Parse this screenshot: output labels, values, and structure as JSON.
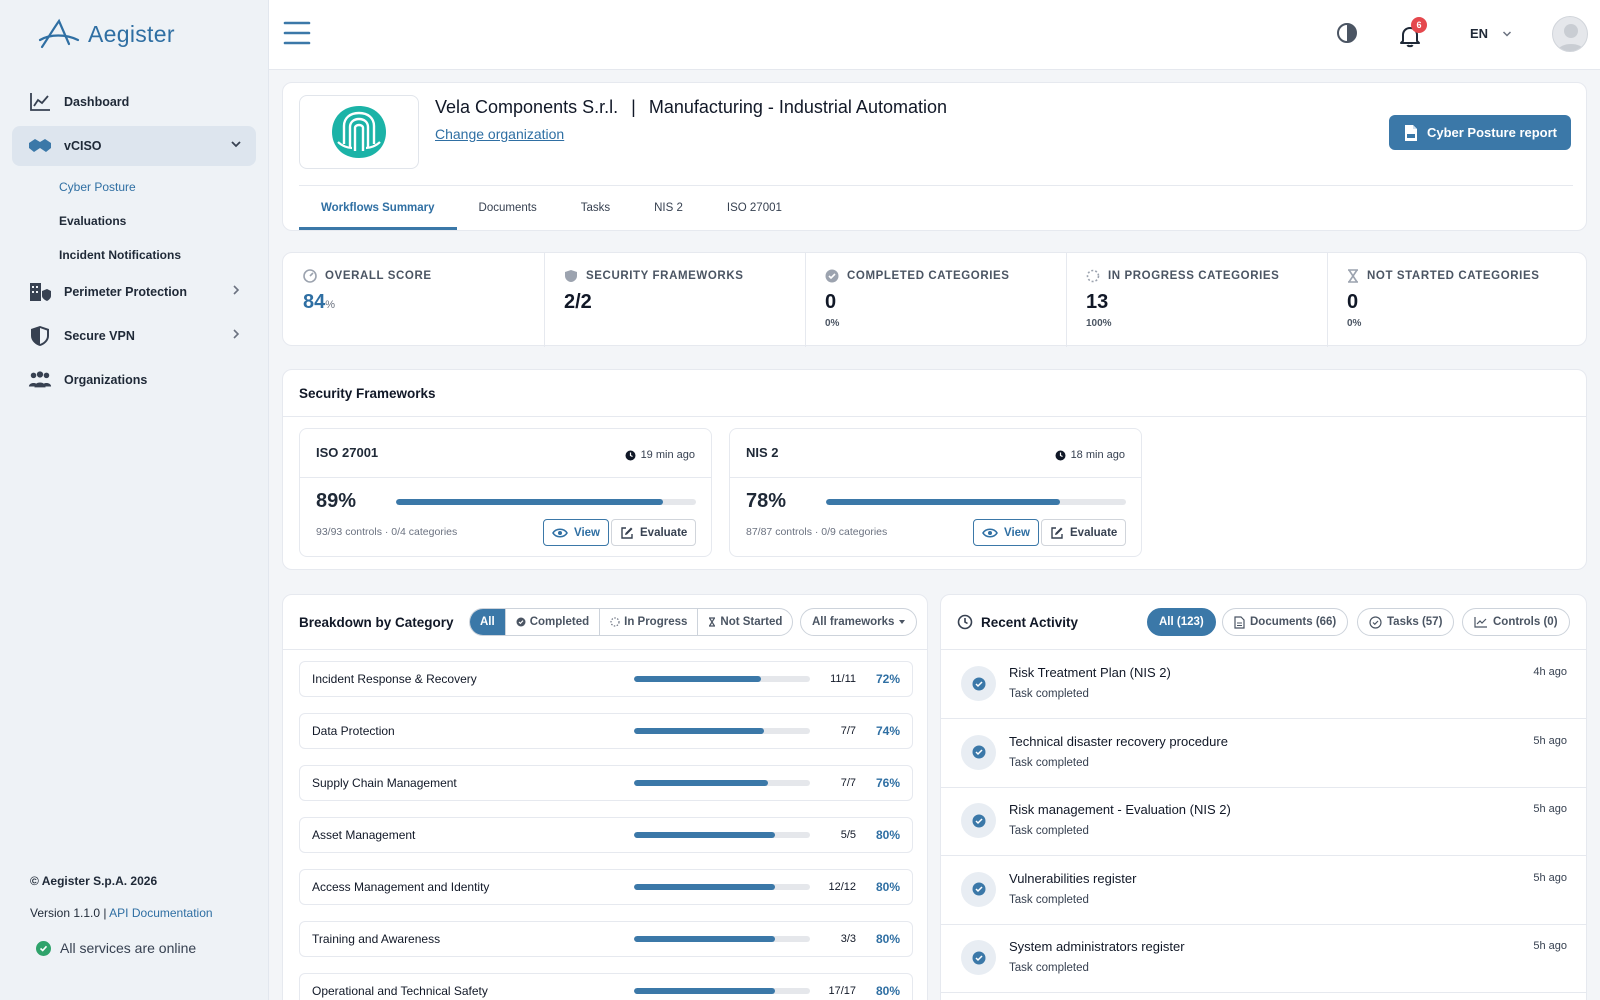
{
  "brand": {
    "name": "Aegister"
  },
  "sidebar": {
    "items": [
      {
        "label": "Dashboard"
      },
      {
        "label": "vCISO"
      },
      {
        "label": "Perimeter Protection"
      },
      {
        "label": "Secure VPN"
      },
      {
        "label": "Organizations"
      }
    ],
    "vciso_sub": [
      {
        "label": "Cyber Posture"
      },
      {
        "label": "Evaluations"
      },
      {
        "label": "Incident Notifications"
      }
    ],
    "footer": {
      "copyright": "© Aegister S.p.A. 2026",
      "version": "Version 1.1.0 |",
      "api_link": "API Documentation",
      "status": "All services are online"
    }
  },
  "topbar": {
    "notifications_count": "6",
    "language": "EN"
  },
  "org": {
    "name": "Vela Components S.r.l.",
    "separator": "|",
    "industry": "Manufacturing - Industrial Automation",
    "change_link": "Change organization",
    "report_button": "Cyber Posture report"
  },
  "tabs": [
    {
      "label": "Workflows Summary"
    },
    {
      "label": "Documents"
    },
    {
      "label": "Tasks"
    },
    {
      "label": "NIS 2"
    },
    {
      "label": "ISO 27001"
    }
  ],
  "stats": {
    "overall": {
      "label": "OVERALL SCORE",
      "value": "84",
      "unit": "%"
    },
    "frameworks": {
      "label": "SECURITY FRAMEWORKS",
      "value": "2/2"
    },
    "completed": {
      "label": "COMPLETED CATEGORIES",
      "value": "0",
      "sub": "0%"
    },
    "in_progress": {
      "label": "IN PROGRESS CATEGORIES",
      "value": "13",
      "sub": "100%"
    },
    "not_started": {
      "label": "NOT STARTED CATEGORIES",
      "value": "0",
      "sub": "0%"
    }
  },
  "security_frameworks": {
    "title": "Security Frameworks",
    "items": [
      {
        "name": "ISO 27001",
        "time": "19 min ago",
        "percent": "89%",
        "progress": 0.89,
        "info": "93/93 controls · 0/4 categories",
        "view": "View",
        "evaluate": "Evaluate"
      },
      {
        "name": "NIS 2",
        "time": "18 min ago",
        "percent": "78%",
        "progress": 0.78,
        "info": "87/87 controls · 0/9 categories",
        "view": "View",
        "evaluate": "Evaluate"
      }
    ]
  },
  "breakdown": {
    "title": "Breakdown by Category",
    "filters": [
      "All",
      "Completed",
      "In Progress",
      "Not Started"
    ],
    "framework_select": "All frameworks",
    "rows": [
      {
        "name": "Incident Response & Recovery",
        "count": "11/11",
        "percent": "72%",
        "progress": 0.72
      },
      {
        "name": "Data Protection",
        "count": "7/7",
        "percent": "74%",
        "progress": 0.74
      },
      {
        "name": "Supply Chain Management",
        "count": "7/7",
        "percent": "76%",
        "progress": 0.76
      },
      {
        "name": "Asset Management",
        "count": "5/5",
        "percent": "80%",
        "progress": 0.8
      },
      {
        "name": "Access Management and Identity",
        "count": "12/12",
        "percent": "80%",
        "progress": 0.8
      },
      {
        "name": "Training and Awareness",
        "count": "3/3",
        "percent": "80%",
        "progress": 0.8
      },
      {
        "name": "Operational and Technical Safety",
        "count": "17/17",
        "percent": "80%",
        "progress": 0.8
      }
    ]
  },
  "activity": {
    "title": "Recent Activity",
    "filters": [
      "All (123)",
      "Documents (66)",
      "Tasks (57)",
      "Controls (0)"
    ],
    "items": [
      {
        "title": "Risk Treatment Plan (NIS 2)",
        "status": "Task completed",
        "time": "4h ago"
      },
      {
        "title": "Technical disaster recovery procedure",
        "status": "Task completed",
        "time": "5h ago"
      },
      {
        "title": "Risk management - Evaluation (NIS 2)",
        "status": "Task completed",
        "time": "5h ago"
      },
      {
        "title": "Vulnerabilities register",
        "status": "Task completed",
        "time": "5h ago"
      },
      {
        "title": "System administrators register",
        "status": "Task completed",
        "time": "5h ago"
      }
    ]
  },
  "colors": {
    "accent": "#3b78a8",
    "link": "#2f6fa3",
    "online": "#2fa36b",
    "badge": "#e5484d"
  }
}
